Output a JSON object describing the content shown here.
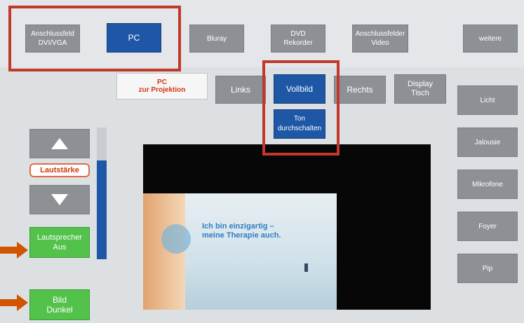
{
  "top_bar": {
    "items": [
      {
        "label": "Anschlussfeld\nDVI/VGA"
      },
      {
        "label": "PC"
      },
      {
        "label": "Bluray"
      },
      {
        "label": "DVD\nRekorder"
      },
      {
        "label": "Anschlussfelder\nVideo"
      },
      {
        "label": "weitere"
      }
    ]
  },
  "source_tabs": {
    "active_title": "PC",
    "active_subtitle": "zur Projektion",
    "links": "Links",
    "vollbild": "Vollbild",
    "rechts": "Rechts",
    "display_tisch": "Display\nTisch",
    "ton_durchschalten": "Ton\ndurchschalten"
  },
  "volume": {
    "label": "Lautstärke",
    "level_percent": 75
  },
  "left_controls": {
    "lautsprecher_aus": "Lautsprecher\nAus",
    "bild_dunkel": "Bild\nDunkel"
  },
  "right_controls": {
    "items": [
      "Licht",
      "Jalousie",
      "Mikrofone",
      "Foyer",
      "Pip"
    ]
  },
  "preview": {
    "headline_line1": "Ich bin einzigartig –",
    "headline_line2": "meine Therapie auch."
  },
  "colors": {
    "accent_blue": "#1d57a5",
    "green": "#52c24a",
    "annotation_red": "#c0392b"
  }
}
